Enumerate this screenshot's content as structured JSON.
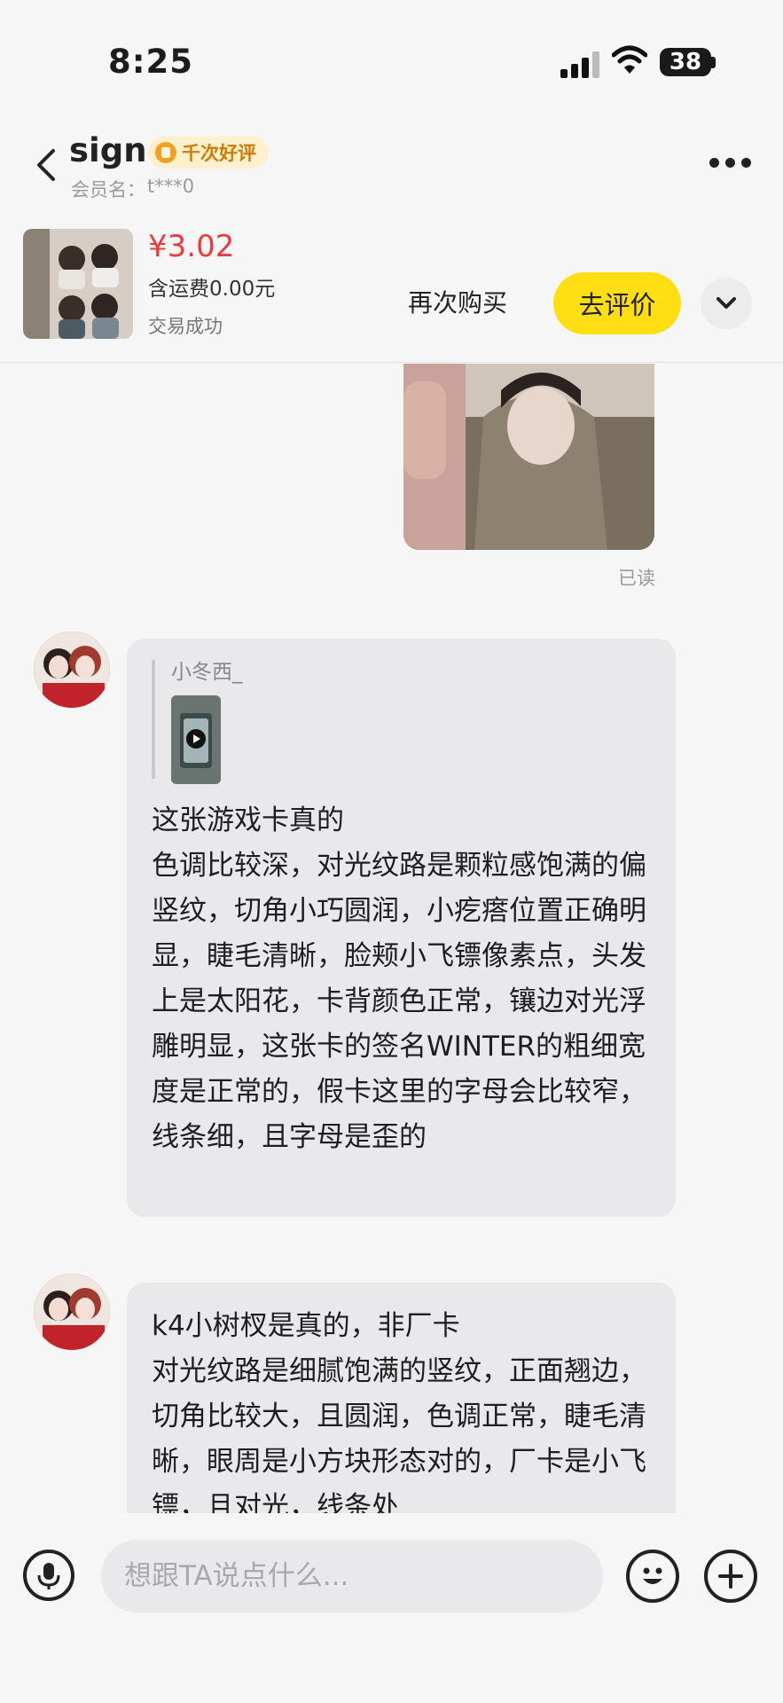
{
  "status_bar": {
    "time": "8:25",
    "battery": "38"
  },
  "header": {
    "title": "sign",
    "badge": "千次好评",
    "member_label": "会员名：",
    "member_value": "t***0"
  },
  "product": {
    "price": "¥3.02",
    "shipping": "含运费0.00元",
    "status": "交易成功",
    "rebuy_label": "再次购买",
    "review_label": "去评价"
  },
  "messages": {
    "read_status": "已读",
    "msg1": {
      "quote_name": "小冬西_",
      "text": "这张游戏卡真的\n色调比较深，对光纹路是颗粒感饱满的偏竖纹，切角小巧圆润，小疙瘩位置正确明显，睫毛清晰，脸颊小飞镖像素点，头发上是太阳花，卡背颜色正常，镶边对光浮雕明显，这张卡的签名WINTER的粗细宽度是正常的，假卡这里的字母会比较窄，线条细，且字母是歪的"
    },
    "msg2": {
      "text": "k4小树杈是真的，非厂卡\n对光纹路是细腻饱满的竖纹，正面翘边，切角比较大，且圆润，色调正常，睫毛清晰，眼周是小方块形态对的，厂卡是小飞镖，且对光，线条处"
    }
  },
  "input": {
    "placeholder": "想跟TA说点什么..."
  },
  "colors": {
    "accent": "#ffde13",
    "price": "#ef3a3a",
    "badge_text": "#cf7a00",
    "badge_bg": "#fdf0cc",
    "bubble": "#e9e9ec"
  }
}
